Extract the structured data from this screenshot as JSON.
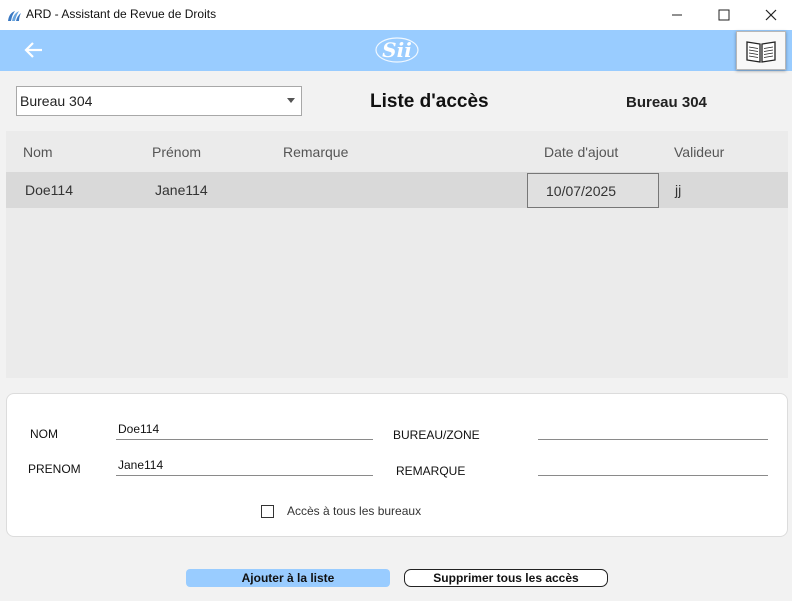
{
  "window": {
    "title": "ARD - Assistant de Revue de Droits",
    "minimize_symbol": "—",
    "maximize_symbol": "☐",
    "close_symbol": "✕",
    "app_icon": "sii-logo-icon"
  },
  "header": {
    "background": "#99ccff",
    "back_icon": "arrow-left-icon",
    "logo": "sii-logo",
    "help_icon": "open-book-icon"
  },
  "toolbar": {
    "bureau_select_value": "Bureau 304",
    "page_title": "Liste d'accès",
    "current_bureau": "Bureau 304"
  },
  "grid": {
    "columns": [
      "Nom",
      "Prénom",
      "Remarque",
      "Date d'ajout",
      "Valideur"
    ],
    "rows": [
      {
        "nom": "Doe114",
        "prenom": "Jane114",
        "remarque": "",
        "date": "10/07/2025",
        "valideur": "jj"
      }
    ]
  },
  "form": {
    "nom_label": "NOM",
    "nom_value": "Doe114",
    "prenom_label": "PRENOM",
    "prenom_value": "Jane114",
    "bureau_zone_label": "BUREAU/ZONE",
    "bureau_zone_value": "",
    "remarque_label": "REMARQUE",
    "remarque_value": "",
    "all_offices_label": "Accès à tous les bureaux",
    "all_offices_checked": false
  },
  "actions": {
    "add_label": "Ajouter à la liste",
    "delete_all_label": "Supprimer tous les accès"
  }
}
